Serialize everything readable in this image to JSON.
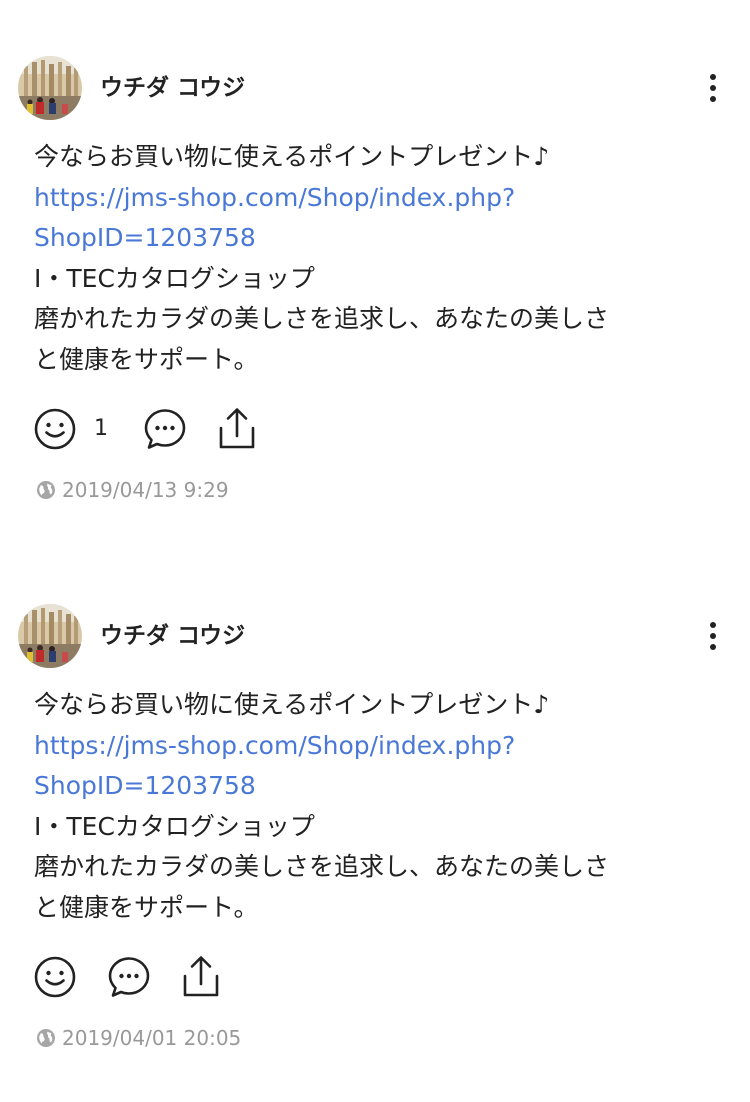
{
  "posts": [
    {
      "author": "ウチダ コウジ",
      "text_line1": "今ならお買い物に使えるポイントプレゼント♪",
      "link_line1": "https://jms-shop.com/Shop/index.php?",
      "link_line2": "ShopID=1203758",
      "text_line2": "I・TECカタログショップ",
      "text_line3": "磨かれたカラダの美しさを追求し、あなたの美しさ",
      "text_line4": "と健康をサポート。",
      "reaction_count": "1",
      "timestamp": "2019/04/13 9:29"
    },
    {
      "author": "ウチダ コウジ",
      "text_line1": "今ならお買い物に使えるポイントプレゼント♪",
      "link_line1": "https://jms-shop.com/Shop/index.php?",
      "link_line2": "ShopID=1203758",
      "text_line2": "I・TECカタログショップ",
      "text_line3": "磨かれたカラダの美しさを追求し、あなたの美しさ",
      "text_line4": "と健康をサポート。",
      "reaction_count": "",
      "timestamp": "2019/04/01 20:05"
    }
  ],
  "icons": {
    "more": "more-vertical-icon",
    "reaction": "smiley-icon",
    "comment": "comment-bubble-icon",
    "share": "share-icon",
    "visibility": "globe-icon"
  },
  "colors": {
    "text": "#222222",
    "link": "#4a78d6",
    "meta": "#999999"
  }
}
